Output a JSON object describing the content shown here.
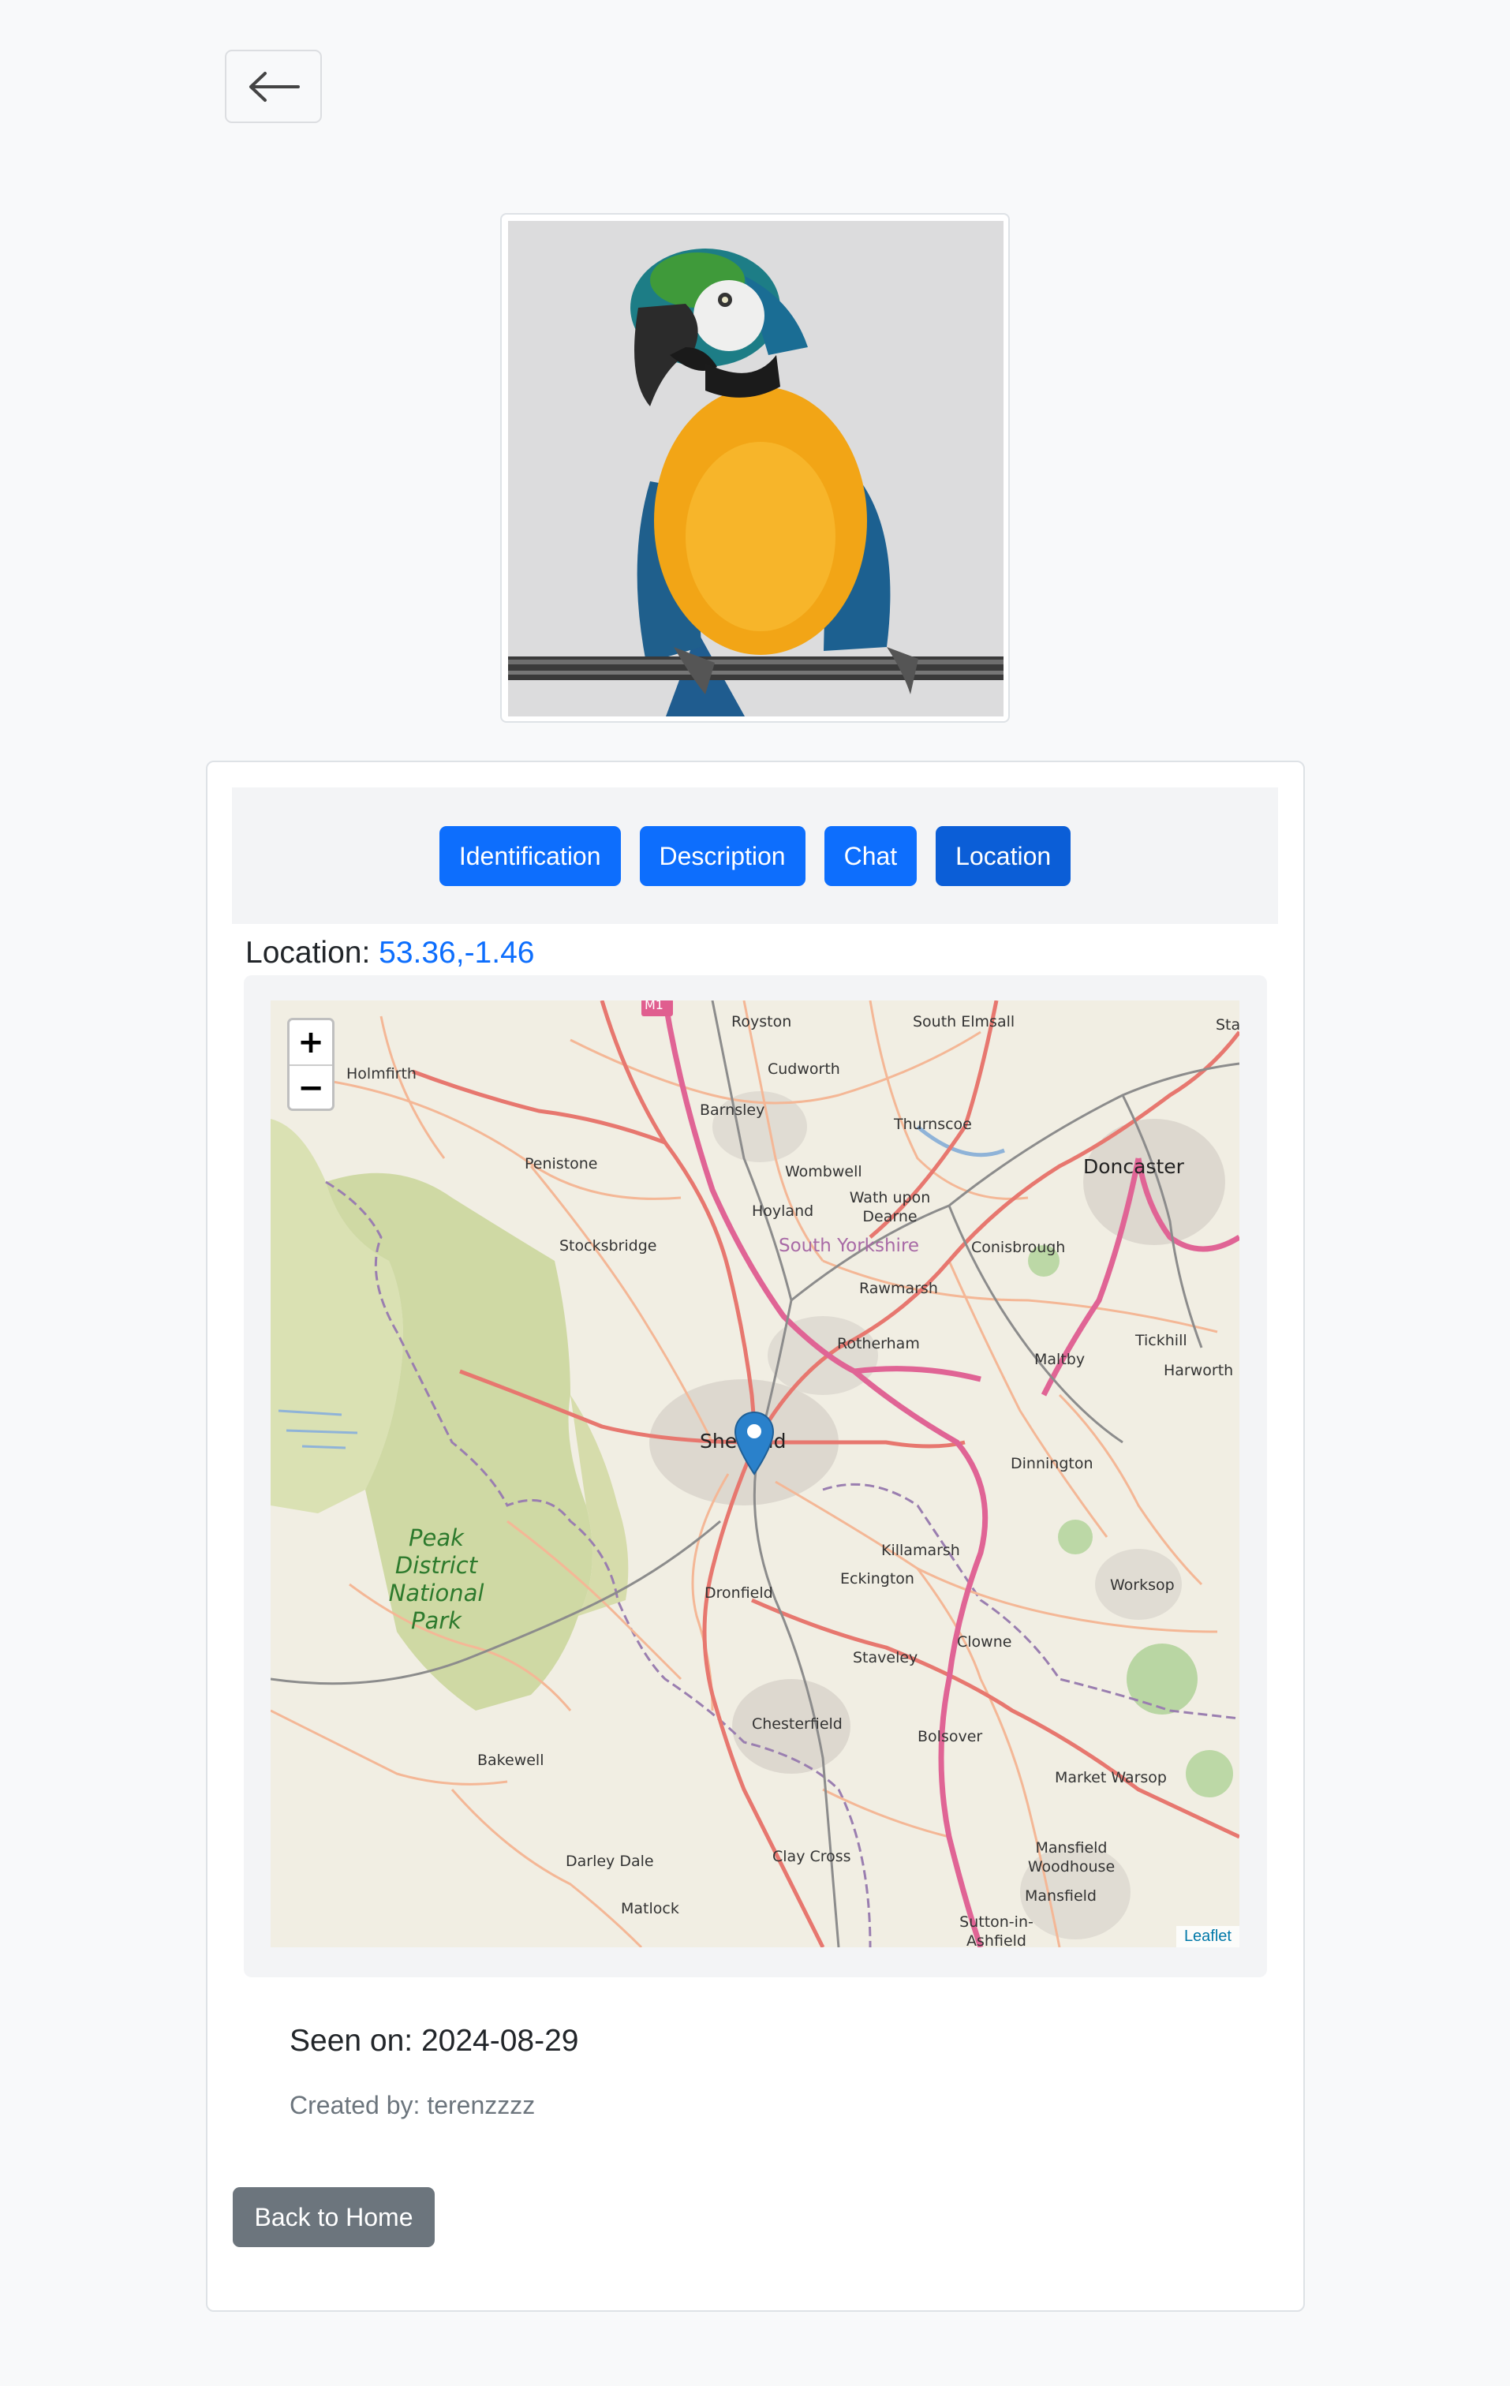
{
  "header": {
    "back_icon": "arrow-left-icon"
  },
  "photo": {
    "subject": "parrot-photo"
  },
  "tabs": [
    {
      "label": "Identification"
    },
    {
      "label": "Description"
    },
    {
      "label": "Chat"
    },
    {
      "label": "Location"
    }
  ],
  "active_tab": "Location",
  "location": {
    "label": "Location:",
    "coords": "53.36,-1.46"
  },
  "map": {
    "zoom_in": "+",
    "zoom_out": "−",
    "attribution": "Leaflet",
    "places": {
      "m1": "M1",
      "royston": "Royston",
      "south_elmsall": "South Elmsall",
      "sta": "Sta",
      "holmfirth": "Holmfirth",
      "cudworth": "Cudworth",
      "barnsley": "Barnsley",
      "thurnscoe": "Thurnscoe",
      "penistone": "Penistone",
      "wombwell": "Wombwell",
      "doncaster": "Doncaster",
      "hoyland": "Hoyland",
      "wath": "Wath upon Dearne",
      "stocksbridge": "Stocksbridge",
      "south_yorkshire": "South Yorkshire",
      "conisbrough": "Conisbrough",
      "rawmarsh": "Rawmarsh",
      "rotherham": "Rotherham",
      "maltby": "Maltby",
      "tickhill": "Tickhill",
      "harworth": "Harworth",
      "sheffield": "Sheffield",
      "dinnington": "Dinnington",
      "peak_district": "Peak District National Park",
      "killamarsh": "Killamarsh",
      "eckington": "Eckington",
      "dronfield": "Dronfield",
      "worksop": "Worksop",
      "clowne": "Clowne",
      "staveley": "Staveley",
      "chesterfield": "Chesterfield",
      "bolsover": "Bolsover",
      "bakewell": "Bakewell",
      "market_warsop": "Market Warsop",
      "mansfield_woodhouse": "Mansfield Woodhouse",
      "darley_dale": "Darley Dale",
      "clay_cross": "Clay Cross",
      "mansfield": "Mansfield",
      "matlock": "Matlock",
      "sutton": "Sutton-in-Ashfield"
    }
  },
  "seen_on": "Seen on: 2024-08-29",
  "created_by": "Created by: terenzzzz",
  "home_button": "Back to Home",
  "colors": {
    "primary": "#0d6efd",
    "primary_active": "#0b5ed7",
    "secondary": "#6c757d",
    "marker": "#2a81cb"
  }
}
